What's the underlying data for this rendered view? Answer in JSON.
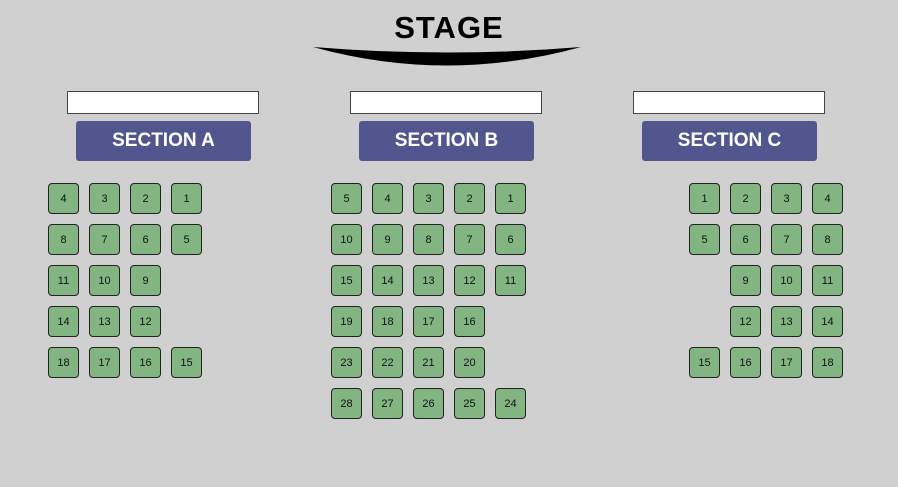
{
  "stage": {
    "label": "STAGE"
  },
  "sections": [
    {
      "key": "a",
      "title": "SECTION A",
      "input_value": "",
      "rows": [
        [
          "4",
          "3",
          "2",
          "1"
        ],
        [
          "8",
          "7",
          "6",
          "5"
        ],
        [
          "11",
          "10",
          "9"
        ],
        [
          "14",
          "13",
          "12"
        ],
        [
          "18",
          "17",
          "16",
          "15"
        ]
      ]
    },
    {
      "key": "b",
      "title": "SECTION B",
      "input_value": "",
      "rows": [
        [
          "5",
          "4",
          "3",
          "2",
          "1"
        ],
        [
          "10",
          "9",
          "8",
          "7",
          "6"
        ],
        [
          "15",
          "14",
          "13",
          "12",
          "11"
        ],
        [
          "19",
          "18",
          "17",
          "16"
        ],
        [
          "23",
          "22",
          "21",
          "20"
        ],
        [
          "28",
          "27",
          "26",
          "25",
          "24"
        ]
      ]
    },
    {
      "key": "c",
      "title": "SECTION C",
      "input_value": "",
      "rows": [
        [
          "1",
          "2",
          "3",
          "4"
        ],
        [
          "5",
          "6",
          "7",
          "8"
        ],
        [
          "",
          "9",
          "10",
          "11"
        ],
        [
          "",
          "12",
          "13",
          "14"
        ],
        [
          "15",
          "16",
          "17",
          "18"
        ]
      ]
    }
  ],
  "colors": {
    "background": "#d0d0d0",
    "section_header": "#52568e",
    "seat_available": "#82b582"
  }
}
